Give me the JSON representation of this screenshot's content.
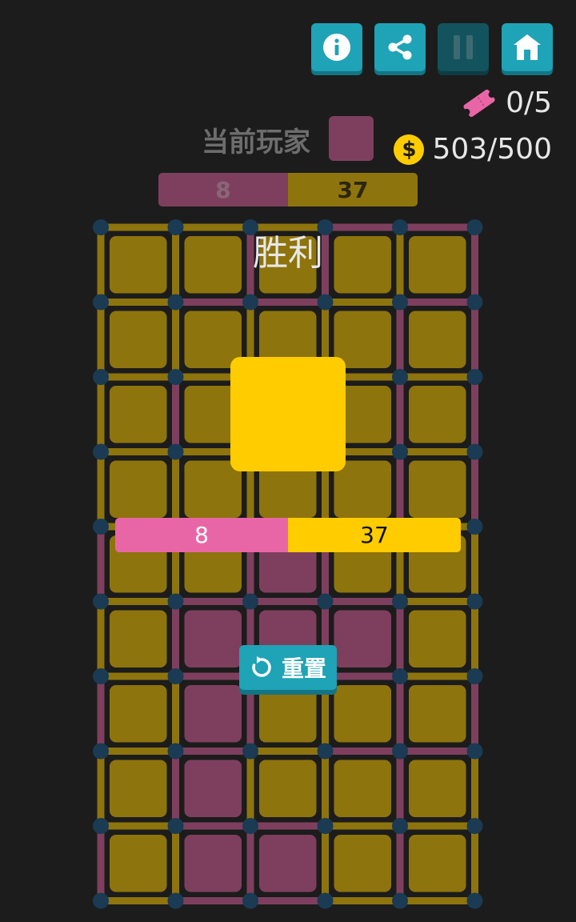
{
  "toolbar": {
    "buttons": [
      {
        "name": "info-button",
        "icon": "info-icon"
      },
      {
        "name": "share-button",
        "icon": "share-icon"
      },
      {
        "name": "pause-button",
        "icon": "pause-icon",
        "disabled": true
      },
      {
        "name": "home-button",
        "icon": "home-icon"
      }
    ]
  },
  "stats": {
    "tickets": "0/5",
    "ticket_icon": "ticket-icon",
    "coins": "503/500",
    "coin_symbol": "$"
  },
  "game": {
    "current_player_label": "当前玩家",
    "current_player_color": "#e063a0",
    "score_pink": "8",
    "score_yellow": "37",
    "colors": {
      "pink": "#e063a0",
      "yellow": "#ffcc00",
      "dot": "#1a5a8a"
    },
    "board": {
      "cols": 5,
      "rows": 9,
      "cells": [
        [
          "Y",
          "Y",
          "Y",
          "Y",
          "Y"
        ],
        [
          "Y",
          "Y",
          "Y",
          "Y",
          "Y"
        ],
        [
          "Y",
          "Y",
          "Y",
          "Y",
          "Y"
        ],
        [
          "Y",
          "Y",
          "Y",
          "Y",
          "Y"
        ],
        [
          "Y",
          "Y",
          "P",
          "Y",
          "Y"
        ],
        [
          "Y",
          "P",
          "P",
          "P",
          "Y"
        ],
        [
          "Y",
          "P",
          "Y",
          "Y",
          "Y"
        ],
        [
          "Y",
          "P",
          "Y",
          "Y",
          "Y"
        ],
        [
          "Y",
          "P",
          "P",
          "Y",
          "Y"
        ]
      ],
      "h_lines": [
        [
          "Y",
          "Y",
          "Y",
          "P",
          "P"
        ],
        [
          "Y",
          "P",
          "P",
          "Y",
          "P"
        ],
        [
          "Y",
          "Y",
          "Y",
          "Y",
          "Y"
        ],
        [
          "Y",
          "Y",
          "Y",
          "Y",
          "Y"
        ],
        [
          "Y",
          "Y",
          "P",
          "Y",
          "Y"
        ],
        [
          "Y",
          "P",
          "P",
          "P",
          "Y"
        ],
        [
          "Y",
          "P",
          "P",
          "P",
          "Y"
        ],
        [
          "Y",
          "P",
          "Y",
          "P",
          "P"
        ],
        [
          "Y",
          "P",
          "P",
          "Y",
          "Y"
        ],
        [
          "Y",
          "P",
          "P",
          "Y",
          "Y"
        ]
      ],
      "v_lines": [
        [
          "Y",
          "Y",
          "P",
          "P",
          "Y",
          "P"
        ],
        [
          "Y",
          "Y",
          "Y",
          "Y",
          "P",
          "P"
        ],
        [
          "Y",
          "P",
          "Y",
          "Y",
          "P",
          "P"
        ],
        [
          "Y",
          "Y",
          "Y",
          "Y",
          "P",
          "P"
        ],
        [
          "P",
          "Y",
          "P",
          "P",
          "Y",
          "Y"
        ],
        [
          "Y",
          "P",
          "P",
          "P",
          "P",
          "Y"
        ],
        [
          "P",
          "Y",
          "P",
          "Y",
          "P",
          "P"
        ],
        [
          "Y",
          "P",
          "Y",
          "Y",
          "P",
          "Y"
        ],
        [
          "P",
          "Y",
          "P",
          "Y",
          "P",
          "Y"
        ]
      ]
    }
  },
  "result": {
    "title": "胜利",
    "winner_color": "#ffcc00",
    "score_pink": "8",
    "score_yellow": "37",
    "reset_label": "重置",
    "reset_icon": "reset-icon"
  }
}
